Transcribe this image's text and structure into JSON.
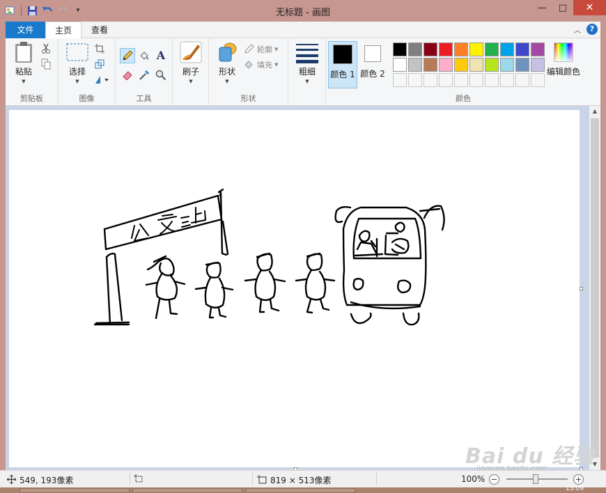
{
  "window": {
    "title": "无标题 - 画图",
    "minimize_glyph": "—",
    "maximize_glyph": "□",
    "close_glyph": "✕"
  },
  "quick_access": [
    "app-menu-icon",
    "save-icon",
    "undo-icon",
    "redo-icon",
    "customize-qat-icon"
  ],
  "tabs": [
    {
      "label": "文件",
      "active": false
    },
    {
      "label": "主页",
      "active": true
    },
    {
      "label": "查看",
      "active": false
    }
  ],
  "ribbon": {
    "clipboard": {
      "label": "剪贴板",
      "paste": "粘贴",
      "icons": [
        "cut-icon",
        "copy-icon"
      ]
    },
    "image": {
      "label": "图像",
      "select": "选择",
      "icons": [
        "crop-icon",
        "resize-icon",
        "rotate-icon"
      ]
    },
    "tools": {
      "label": "工具",
      "icons": [
        "pencil-icon",
        "fill-icon",
        "text-icon",
        "eraser-icon",
        "color-picker-icon",
        "magnifier-icon"
      ]
    },
    "brushes": {
      "label": "刷子"
    },
    "shapes": {
      "label": "形状",
      "shapes_btn": "形状",
      "outline": "轮廓",
      "fill": "填充"
    },
    "size": {
      "label": "粗细"
    },
    "colors": {
      "label": "颜色",
      "color1": "颜色 1",
      "color2": "颜色 2",
      "edit": "编辑颜色",
      "color1_value": "#000000",
      "color2_value": "#ffffff",
      "palette_row1": [
        "#000000",
        "#7f7f7f",
        "#880015",
        "#ed1c24",
        "#ff7f27",
        "#fff200",
        "#22b14c",
        "#00a2e8",
        "#3f48cc",
        "#a349a4"
      ],
      "palette_row2": [
        "#ffffff",
        "#c3c3c3",
        "#b97a57",
        "#ffaec9",
        "#ffc90e",
        "#efe4b0",
        "#b5e61d",
        "#99d9ea",
        "#7092be",
        "#c8bfe7"
      ],
      "custom_slots": 10
    }
  },
  "canvas": {
    "sign_text": "公交站"
  },
  "status": {
    "cursor_pos": "549, 193像素",
    "selection_size": "",
    "image_size": "819 × 513像素",
    "zoom": "100%",
    "zoom_out": "−",
    "zoom_in": "+"
  },
  "watermark": {
    "brand": "Bai du 经验",
    "url": "jingyan.baidu.com"
  },
  "taskbar": {
    "clock": "13:09"
  }
}
